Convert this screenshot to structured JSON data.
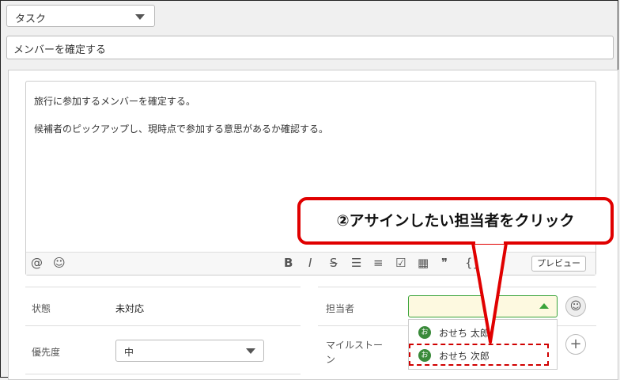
{
  "issue_type": {
    "value": "タスク"
  },
  "summary": {
    "value": "メンバーを確定する"
  },
  "description": {
    "line1": "旅行に参加するメンバーを確定する。",
    "line2": "候補者のピックアップし、現時点で参加する意思があるか確認する。"
  },
  "toolbar": {
    "mention": "@",
    "emoji": "☺",
    "bold": "B",
    "italic": "I",
    "strike": "S",
    "bullet_list": "☰",
    "numbered_list": "≡",
    "checklist": "☑",
    "table": "▦",
    "quote": "❞",
    "code": "{}",
    "preview_label": "プレビュー"
  },
  "fields": {
    "status_label": "状態",
    "status_value": "未対応",
    "priority_label": "優先度",
    "priority_value": "中",
    "assignee_label": "担当者",
    "milestone_label": "マイルストーン"
  },
  "assignee_options": [
    {
      "initial": "お",
      "name": "おせち 太郎"
    },
    {
      "initial": "お",
      "name": "おせち 次郎"
    }
  ],
  "icons": {
    "assign_self": "person-icon",
    "add_milestone": "plus-icon"
  },
  "annotation": {
    "text": "②アサインしたい担当者をクリック"
  },
  "colors": {
    "accent_green": "#3aa33a",
    "annotation_red": "#e00000",
    "assignee_bg": "#fdf9e0"
  }
}
